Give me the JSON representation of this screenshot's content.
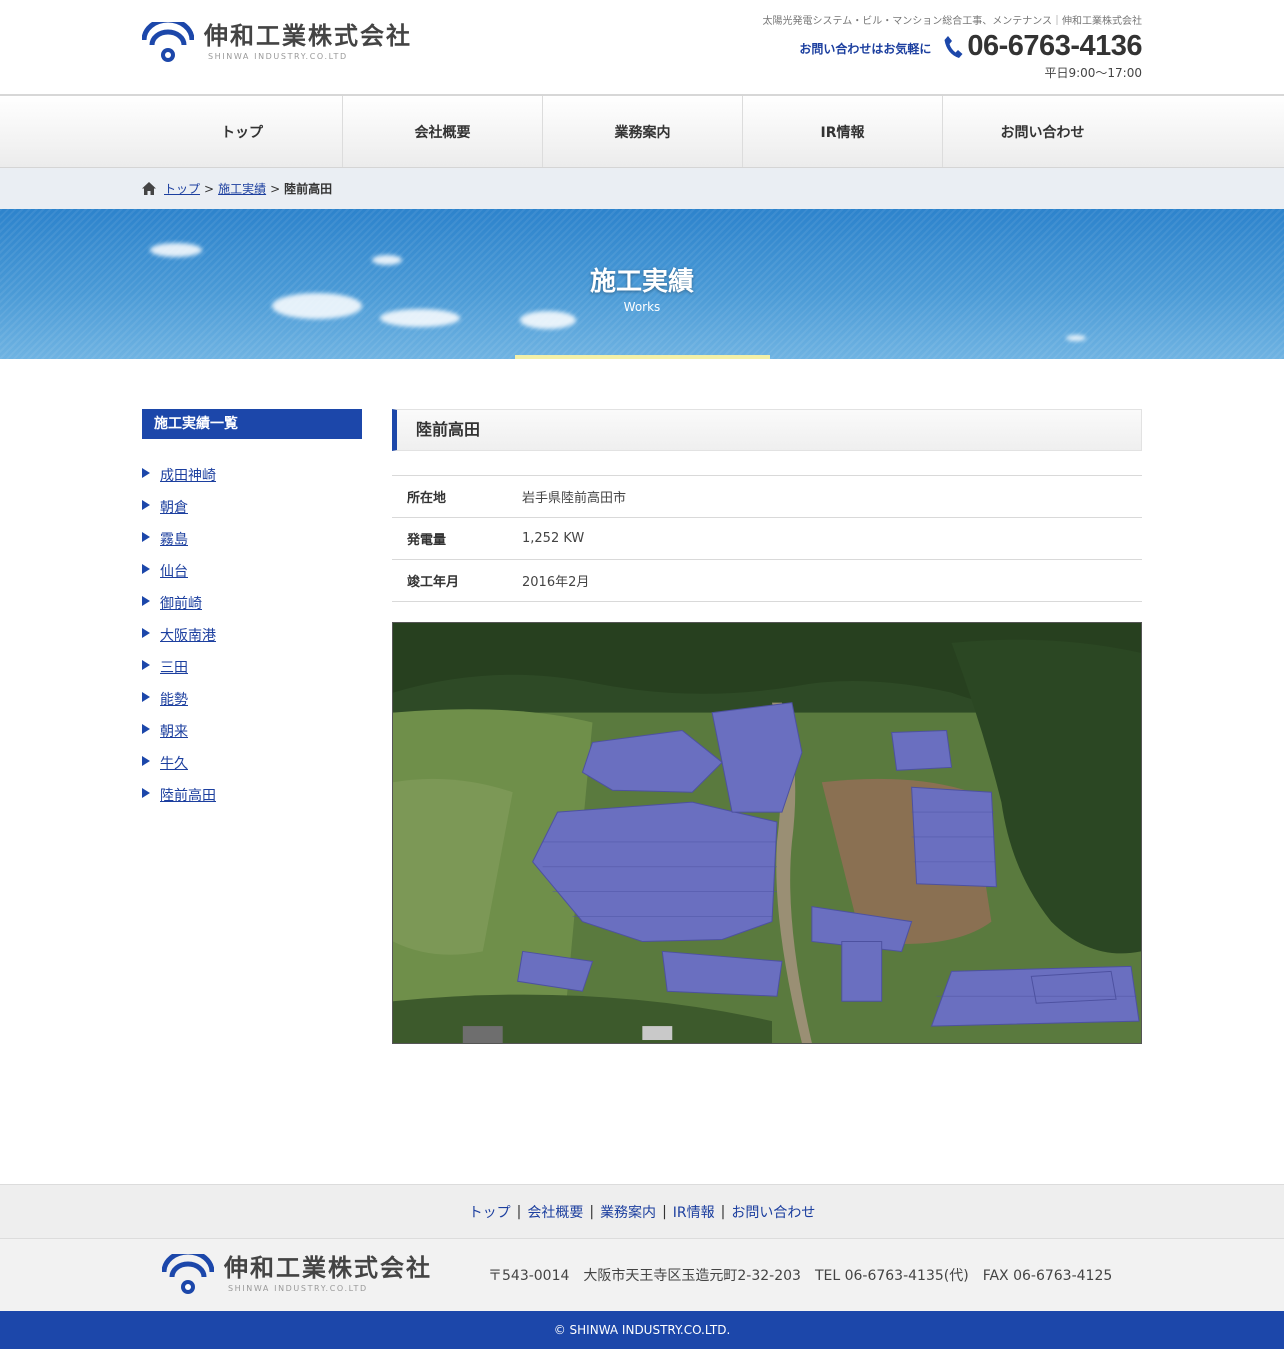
{
  "header": {
    "logo_jp": "伸和工業株式会社",
    "logo_en": "SHINWA INDUSTRY.CO.LTD",
    "tagline": "太陽光発電システム・ビル・マンション総合工事、メンテナンス｜伸和工業株式会社",
    "contact_lead": "お問い合わせはお気軽に",
    "phone": "06-6763-4136",
    "hours": "平日9:00～17:00"
  },
  "nav": [
    "トップ",
    "会社概要",
    "業務案内",
    "IR情報",
    "お問い合わせ"
  ],
  "breadcrumb": {
    "home": "トップ",
    "parent": "施工実績",
    "current": "陸前高田",
    "sep": ">"
  },
  "hero": {
    "title": "施工実績",
    "subtitle": "Works"
  },
  "sidebar": {
    "title": "施工実績一覧",
    "items": [
      "成田神崎",
      "朝倉",
      "霧島",
      "仙台",
      "御前崎",
      "大阪南港",
      "三田",
      "能勢",
      "朝来",
      "牛久",
      "陸前高田"
    ]
  },
  "detail": {
    "title": "陸前高田",
    "rows": [
      {
        "label": "所在地",
        "value": "岩手県陸前高田市"
      },
      {
        "label": "発電量",
        "value": "1,252 KW"
      },
      {
        "label": "竣工年月",
        "value": "2016年2月"
      }
    ]
  },
  "footer": {
    "nav": [
      "トップ",
      "会社概要",
      "業務案内",
      "IR情報",
      "お問い合わせ"
    ],
    "separator": "|",
    "address": "〒543-0014　大阪市天王寺区玉造元町2-32-203　TEL 06-6763-4135(代)　FAX 06-6763-4125",
    "copyright": "© SHINWA INDUSTRY.CO.LTD."
  },
  "colors": {
    "brand_blue": "#1c47aa",
    "link": "#1c3f9f",
    "hero_sky": "#3a8fd2",
    "hero_bar": "#f3f0a8"
  }
}
